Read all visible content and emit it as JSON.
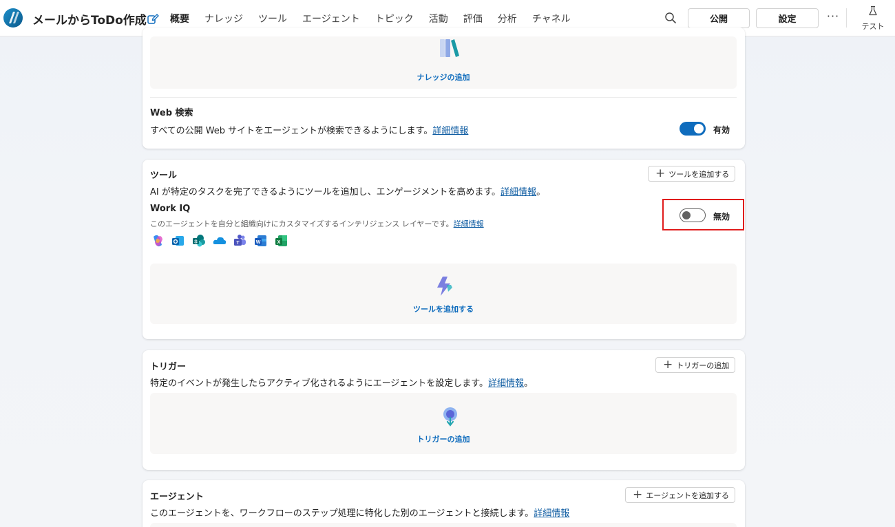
{
  "app": {
    "title": "メールからToDo作成"
  },
  "nav": {
    "tabs": [
      {
        "label": "概要",
        "active": true
      },
      {
        "label": "ナレッジ"
      },
      {
        "label": "ツール"
      },
      {
        "label": "エージェント"
      },
      {
        "label": "トピック"
      },
      {
        "label": "活動"
      },
      {
        "label": "評価"
      },
      {
        "label": "分析"
      },
      {
        "label": "チャネル"
      }
    ]
  },
  "header": {
    "publish_label": "公開",
    "settings_label": "設定",
    "more_label": "···",
    "test_label": "テスト"
  },
  "knowledge": {
    "add_label": "ナレッジの追加",
    "web_search": {
      "title": "Web 検索",
      "description": "すべての公開 Web サイトをエージェントが検索できるようにします。",
      "link": "詳細情報",
      "toggle_state": "有効"
    }
  },
  "tools": {
    "title": "ツール",
    "add_button": "ツールを追加する",
    "description": "AI が特定のタスクを完了できるようにツールを追加し、エンゲージメントを高めます。",
    "link": "詳細情報",
    "suffix": "。",
    "work_iq": {
      "title": "Work IQ",
      "description": "このエージェントを自分と組織向けにカスタマイズするインテリジェンス レイヤーです。",
      "link": "詳細情報",
      "toggle_state": "無効",
      "app_icons": [
        "copilot-icon",
        "outlook-icon",
        "sharepoint-icon",
        "onedrive-icon",
        "teams-icon",
        "word-icon",
        "excel-icon"
      ]
    },
    "empty_add_label": "ツールを追加する"
  },
  "triggers": {
    "title": "トリガー",
    "add_button": "トリガーの追加",
    "description": "特定のイベントが発生したらアクティブ化されるようにエージェントを設定します。",
    "link": "詳細情報",
    "suffix": "。",
    "empty_add_label": "トリガーの追加"
  },
  "agents": {
    "title": "エージェント",
    "add_button": "エージェントを追加する",
    "description": "このエージェントを、ワークフローのステップ処理に特化した別のエージェントと接続します。",
    "link": "詳細情報"
  },
  "colors": {
    "accent": "#0f6cbd",
    "highlight": "#e01b1b"
  }
}
